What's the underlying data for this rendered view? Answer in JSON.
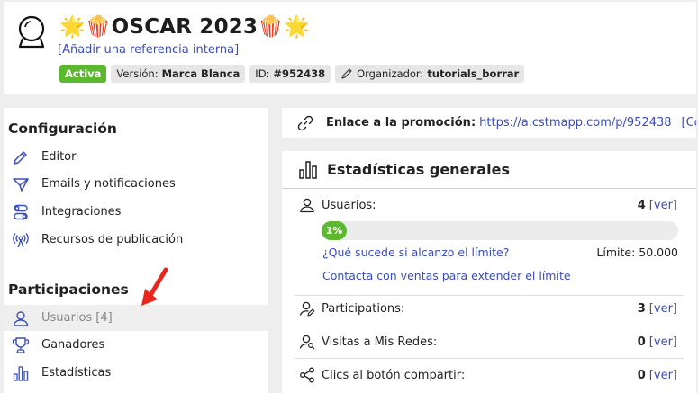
{
  "header": {
    "title": "🌟🍿OSCAR 2023🍿🌟",
    "reference_link": "[Añadir una referencia interna]",
    "status_badge": "Activa",
    "version_label": "Versión:",
    "version_value": "Marca Blanca",
    "id_label": "ID:",
    "id_value": "#952438",
    "organizer_label": "Organizador:",
    "organizer_value": "tutorials_borrar",
    "icons": {
      "logo": "crystal-ball-icon",
      "organizer": "pencil-icon"
    }
  },
  "sidebar": {
    "sections": [
      {
        "title": "Configuración",
        "items": [
          {
            "label": "Editor",
            "icon": "pencil-icon"
          },
          {
            "label": "Emails y notificaciones",
            "icon": "paper-plane-icon"
          },
          {
            "label": "Integraciones",
            "icon": "toggles-icon"
          },
          {
            "label": "Recursos de publicación",
            "icon": "broadcast-icon"
          }
        ]
      },
      {
        "title": "Participaciones",
        "items": [
          {
            "label": "Usuarios [4]",
            "icon": "user-icon",
            "selected": true
          },
          {
            "label": "Ganadores",
            "icon": "trophy-icon"
          },
          {
            "label": "Estadísticas",
            "icon": "bar-chart-icon"
          }
        ]
      }
    ],
    "annotation_color": "#e8261c"
  },
  "promo": {
    "label": "Enlace a la promoción:",
    "url": "https://a.cstmapp.com/p/952438",
    "copy_label": "[Copiar]",
    "extra": "[C",
    "icon": "link-icon"
  },
  "stats": {
    "title": "Estadísticas generales",
    "icon": "bar-chart-icon",
    "users": {
      "label": "Usuarios:",
      "value": "4",
      "ver_open": "[",
      "ver_label": "ver",
      "ver_close": "]",
      "progress_label": "1%",
      "progress_fraction": 0.01,
      "limit_question": "¿Qué sucede si alcanzo el límite?",
      "limit_text": "Límite: 50.000",
      "contact_link": "Contacta con ventas para extender el límite"
    },
    "rows": [
      {
        "label": "Participations:",
        "value": "3",
        "icon": "user-pen-icon"
      },
      {
        "label": "Visitas a Mis Redes:",
        "value": "0",
        "icon": "user-search-icon"
      },
      {
        "label": "Clics al botón compartir:",
        "value": "0",
        "icon": "share-icon"
      }
    ],
    "ver_label": "ver"
  },
  "colors": {
    "accent_green": "#5cb82e",
    "link_blue": "#3a4db8",
    "icon_blue": "#3a4db8",
    "background": "#eeeeee"
  }
}
